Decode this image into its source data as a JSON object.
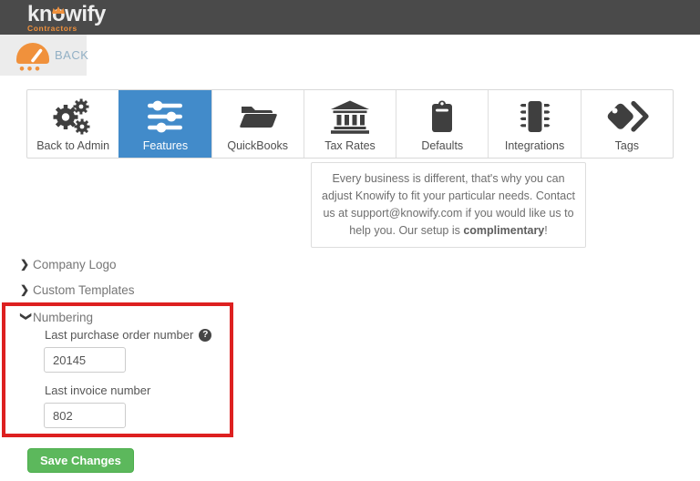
{
  "header": {
    "logo": "knowify",
    "subtitle": "Contractors"
  },
  "back_tab": {
    "label": "BACK"
  },
  "toolbar": {
    "items": [
      {
        "label": "Back to Admin",
        "icon": "gears-icon",
        "active": false
      },
      {
        "label": "Features",
        "icon": "sliders-icon",
        "active": true
      },
      {
        "label": "QuickBooks",
        "icon": "open-folder-icon",
        "active": false
      },
      {
        "label": "Tax Rates",
        "icon": "bank-icon",
        "active": false
      },
      {
        "label": "Defaults",
        "icon": "clipboard-icon",
        "active": false
      },
      {
        "label": "Integrations",
        "icon": "chip-icon",
        "active": false
      },
      {
        "label": "Tags",
        "icon": "tags-icon",
        "active": false
      }
    ]
  },
  "info_box": {
    "text": "Every business is different, that's why you can adjust Knowify to fit your particular needs. Contact us at support@knowify.com if you would like us to help you. Our setup is",
    "highlight": "complimentary",
    "suffix": "!"
  },
  "sections": [
    {
      "label": "Company Logo",
      "state": "collapsed"
    },
    {
      "label": "Custom Templates",
      "state": "collapsed"
    },
    {
      "label": "Numbering",
      "state": "expanded"
    }
  ],
  "numbering_form": {
    "purchase_order_label": "Last purchase order number",
    "purchase_order_value": "20145",
    "invoice_label": "Last invoice number",
    "invoice_value": "802",
    "help_glyph": "?"
  },
  "actions": {
    "save_label": "Save Changes"
  },
  "colors": {
    "header_bg": "#4a4a4a",
    "brand_orange": "#f0913c",
    "active_tab_blue": "#428bca",
    "icon_gray": "#3f3f3f",
    "annotation_red": "#dd2020",
    "save_green": "#5cb85c",
    "back_text": "#92b0c5"
  }
}
